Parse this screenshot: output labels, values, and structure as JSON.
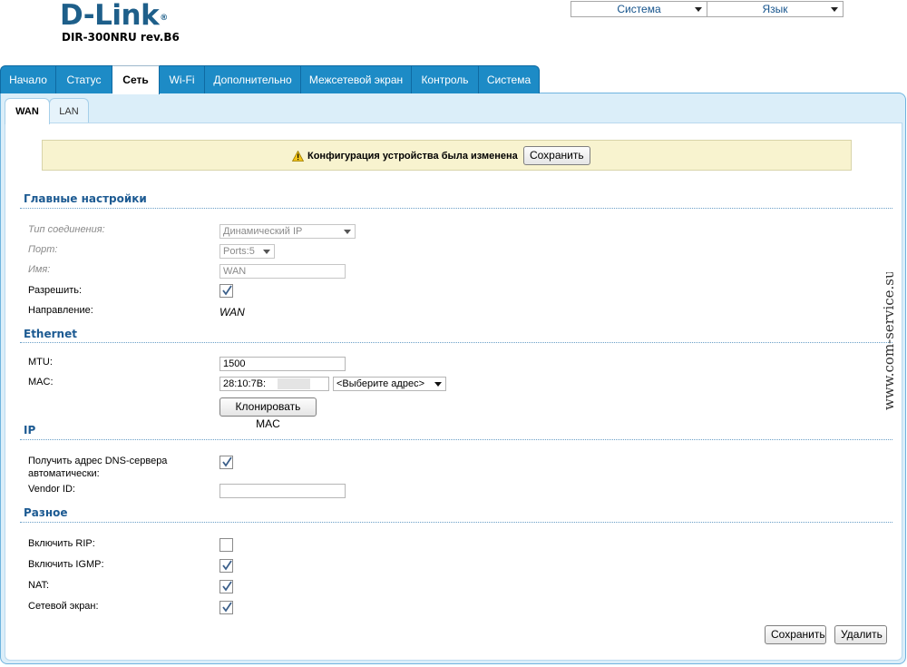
{
  "header": {
    "logo_text": "D-Link",
    "logo_reg": "®",
    "model": "DIR-300NRU rev.B6",
    "system_select": "Система",
    "language_select": "Язык"
  },
  "main_tabs": [
    "Начало",
    "Статус",
    "Сеть",
    "Wi-Fi",
    "Дополнительно",
    "Межсетевой экран",
    "Контроль",
    "Система"
  ],
  "active_tab": "Сеть",
  "sub_tabs": [
    "WAN",
    "LAN"
  ],
  "active_sub_tab": "WAN",
  "notice": {
    "text": "Конфигурация устройства была изменена",
    "save_label": "Сохранить"
  },
  "sections": {
    "main": {
      "title": "Главные настройки",
      "connection_type_label": "Тип соединения:",
      "connection_type_value": "Динамический IP",
      "port_label": "Порт:",
      "port_value": "Ports:5",
      "name_label": "Имя:",
      "name_value": "WAN",
      "enable_label": "Разрешить:",
      "enable_checked": true,
      "direction_label": "Направление:",
      "direction_value": "WAN"
    },
    "ethernet": {
      "title": "Ethernet",
      "mtu_label": "MTU:",
      "mtu_value": "1500",
      "mac_label": "MAC:",
      "mac_value": "28:10:7B:",
      "mac_select": "<Выберите адрес>",
      "clone_mac_label": "Клонировать MAC"
    },
    "ip": {
      "title": "IP",
      "dns_auto_label_1": "Получить адрес DNS-сервера",
      "dns_auto_label_2": "автоматически:",
      "dns_auto_checked": true,
      "vendor_id_label": "Vendor ID:",
      "vendor_id_value": ""
    },
    "misc": {
      "title": "Разное",
      "rip_label": "Включить RIP:",
      "rip_checked": false,
      "igmp_label": "Включить IGMP:",
      "igmp_checked": true,
      "nat_label": "NAT:",
      "nat_checked": true,
      "firewall_label": "Сетевой экран:",
      "firewall_checked": true
    }
  },
  "footer": {
    "save_label": "Сохранить",
    "delete_label": "Удалить"
  },
  "watermark": "www.com-service.su",
  "colors": {
    "tab_blue": "#1d8bc6",
    "heading_blue": "#1c5a92",
    "notice_bg": "#f8f3cf"
  }
}
